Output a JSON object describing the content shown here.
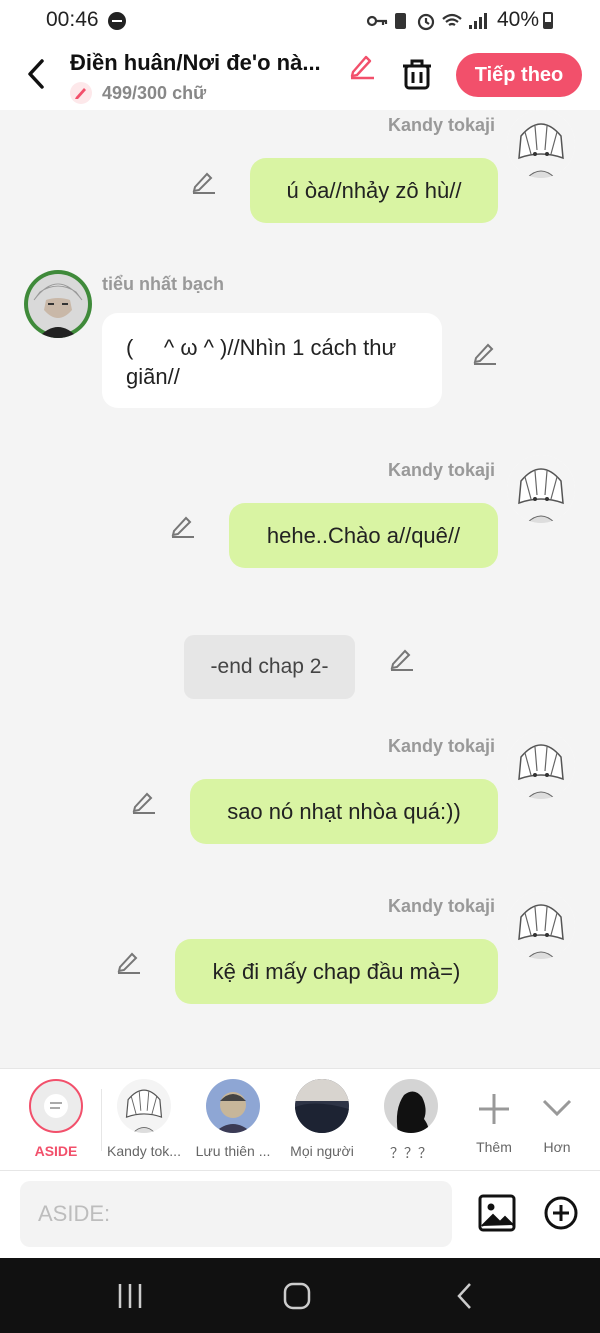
{
  "status_bar": {
    "time": "00:46",
    "battery": "40%",
    "icons": [
      "key-icon",
      "sim-icon",
      "alarm-icon",
      "wifi-icon",
      "signal-icon"
    ]
  },
  "header": {
    "title": "Điền huân/Nơi đe'o nà...",
    "count": "499/300 chữ",
    "next_label": "Tiếp theo"
  },
  "chat": {
    "messages": [
      {
        "sender": "Kandy tokaji",
        "text": "ú òa//nhảy zô hù//",
        "side": "right"
      },
      {
        "sender": "tiểu nhất bạch",
        "text": "(     ^ ω ^ )//Nhìn 1 cách thư giãn//",
        "side": "left"
      },
      {
        "sender": "Kandy tokaji",
        "text": "hehe..Chào a//quê//",
        "side": "right"
      },
      {
        "sender": "",
        "text": "-end chap 2-",
        "side": "center"
      },
      {
        "sender": "Kandy tokaji",
        "text": "sao nó nhạt nhòa quá:))",
        "side": "right"
      },
      {
        "sender": "Kandy tokaji",
        "text": "kệ đi mấy chap đầu mà=)",
        "side": "right"
      }
    ]
  },
  "characters": {
    "aside": "ASIDE",
    "kandy": "Kandy tok...",
    "luu": "Lưu thiên ...",
    "everyone": "Mọi người",
    "unknown": "？？？",
    "more": "Thêm",
    "expand": "Hơn"
  },
  "input": {
    "placeholder": "ASIDE:"
  },
  "colors": {
    "accent": "#f2506b",
    "bubble_green": "#d9f4a3",
    "background": "#f4f4f4"
  }
}
